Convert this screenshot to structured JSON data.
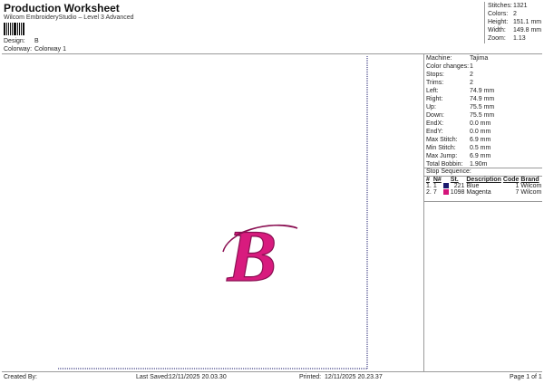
{
  "header": {
    "title": "Production Worksheet",
    "subtitle": "Wilcom EmbroideryStudio – Level 3 Advanced",
    "design_label": "Design:",
    "design_value": "B",
    "colorway_label": "Colorway:",
    "colorway_value": "Colorway 1"
  },
  "summary": [
    {
      "label": "Stitches:",
      "value": "1321"
    },
    {
      "label": "Colors:",
      "value": "2"
    },
    {
      "label": "Height:",
      "value": "151.1 mm"
    },
    {
      "label": "Width:",
      "value": "149.8 mm"
    },
    {
      "label": "Zoom:",
      "value": "1.13"
    }
  ],
  "details": [
    {
      "label": "Machine:",
      "value": "Tajima"
    },
    {
      "label": "Color changes:",
      "value": "1"
    },
    {
      "label": "Stops:",
      "value": "2"
    },
    {
      "label": "Trims:",
      "value": "2"
    },
    {
      "label": "Left:",
      "value": "74.9 mm"
    },
    {
      "label": "Right:",
      "value": "74.9 mm"
    },
    {
      "label": "Up:",
      "value": "75.5 mm"
    },
    {
      "label": "Down:",
      "value": "75.5 mm"
    },
    {
      "label": "EndX:",
      "value": "0.0 mm"
    },
    {
      "label": "EndY:",
      "value": "0.0 mm"
    },
    {
      "label": "Max Stitch:",
      "value": "6.9 mm"
    },
    {
      "label": "Min Stitch:",
      "value": "0.5 mm"
    },
    {
      "label": "Max Jump:",
      "value": "6.9 mm"
    },
    {
      "label": "Total Bobbin:",
      "value": "1.90m"
    }
  ],
  "stop_sequence": {
    "title": "Stop Sequence:",
    "headers": [
      "#",
      "N#",
      "St.",
      "Description",
      "Code",
      "Brand"
    ],
    "rows": [
      {
        "index": "1.",
        "needle": "1",
        "stitches": "221",
        "description": "Blue",
        "code": "1",
        "brand": "Wilcom",
        "color": "#1a1a6e"
      },
      {
        "index": "2.",
        "needle": "7",
        "stitches": "1098",
        "description": "Magenta",
        "code": "7",
        "brand": "Wilcom",
        "color": "#d4147a"
      }
    ]
  },
  "design_preview": {
    "letter": "B",
    "fill_color": "#d81b7e",
    "outline_color": "#8a0f52",
    "guide_color": "#1a1a6e"
  },
  "footer": {
    "created_by_label": "Created By:",
    "last_saved_label": "Last Saved:",
    "last_saved_value": "12/11/2025 20.03.30",
    "printed_label": "Printed:",
    "printed_value": "12/11/2025 20.23.37",
    "page_label": "Page 1 of 1"
  }
}
